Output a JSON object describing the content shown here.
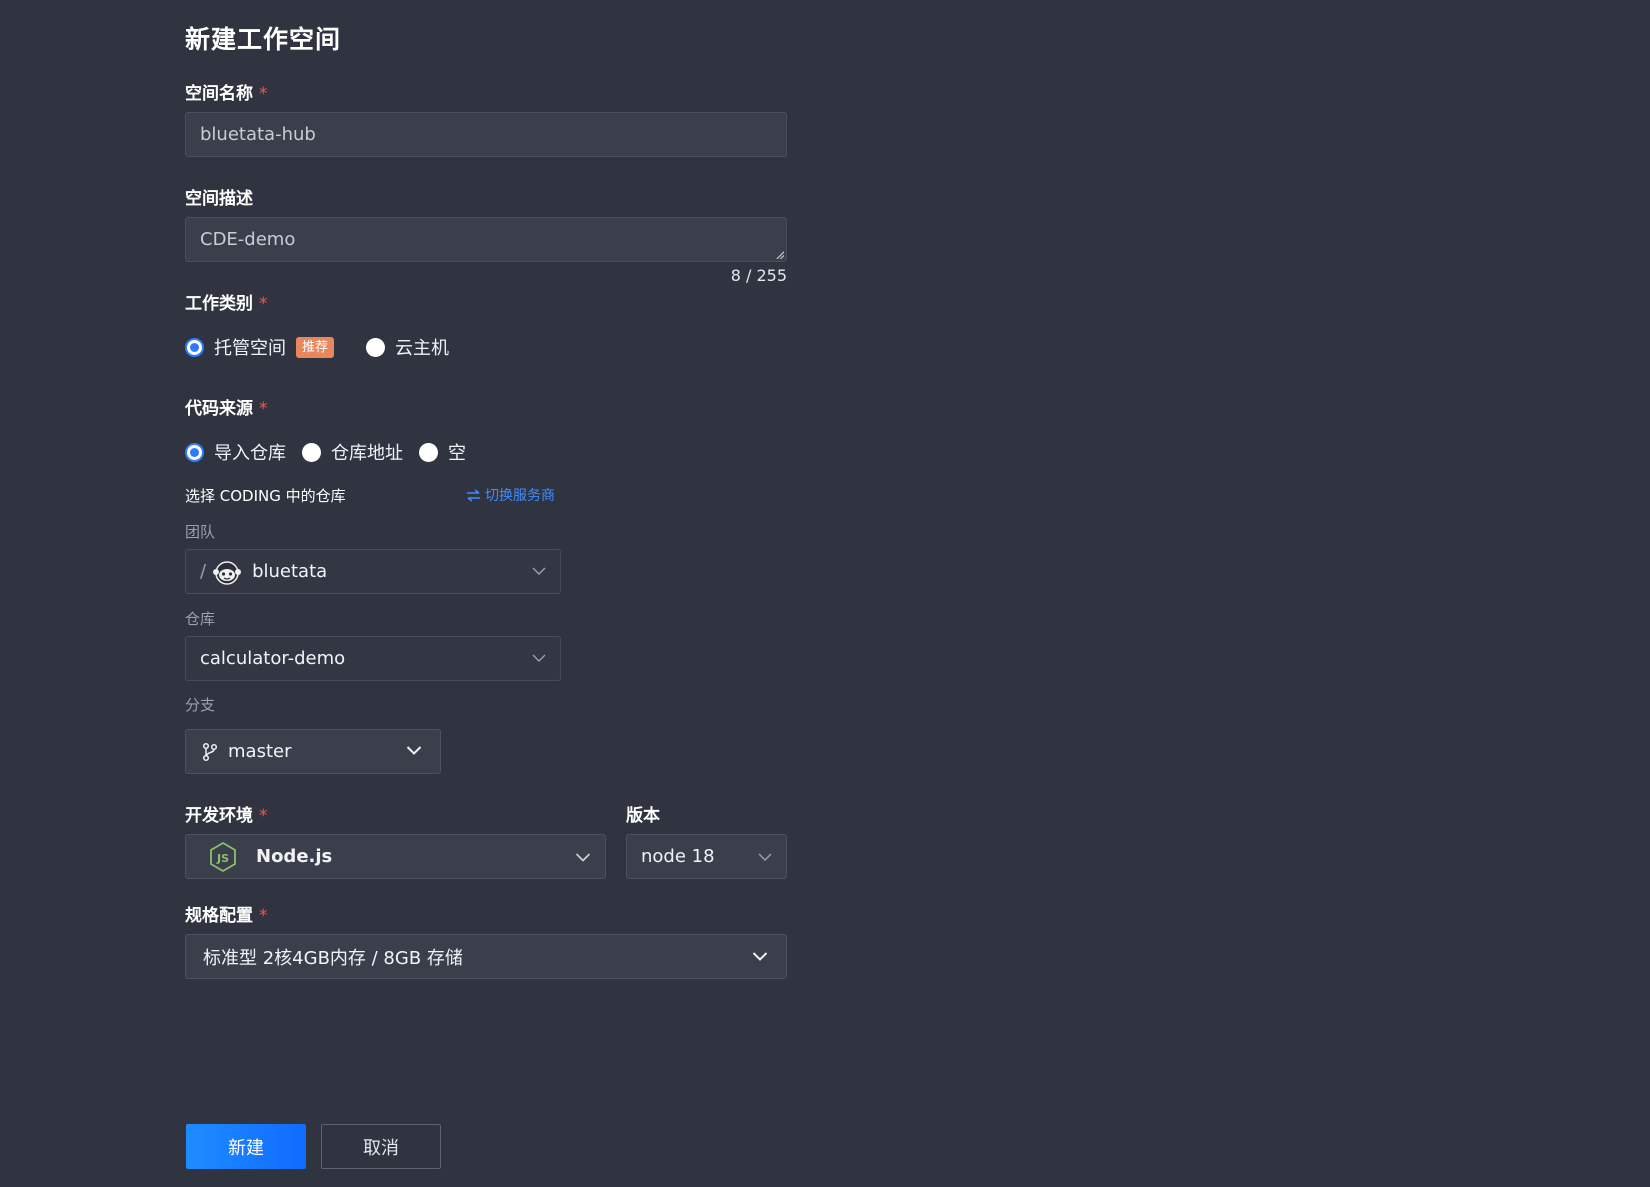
{
  "page": {
    "title": "新建工作空间"
  },
  "space_name": {
    "label": "空间名称",
    "required_mark": "*",
    "value": "bluetata-hub"
  },
  "space_desc": {
    "label": "空间描述",
    "value": "CDE-demo",
    "counter": "8 / 255"
  },
  "work_type": {
    "label": "工作类别",
    "required_mark": "*",
    "options": [
      {
        "label": "托管空间",
        "badge": "推荐",
        "checked": true
      },
      {
        "label": "云主机",
        "checked": false
      }
    ]
  },
  "code_source": {
    "label": "代码来源",
    "required_mark": "*",
    "options": [
      {
        "label": "导入仓库",
        "checked": true
      },
      {
        "label": "仓库地址",
        "checked": false
      },
      {
        "label": "空",
        "checked": false
      }
    ],
    "repo_section_title": "选择 CODING 中的仓库",
    "switch_provider_link": "切换服务商",
    "team": {
      "label": "团队",
      "prefix": "/",
      "value": "bluetata"
    },
    "repo": {
      "label": "仓库",
      "value": "calculator-demo"
    },
    "branch": {
      "label": "分支",
      "value": "master"
    }
  },
  "dev_env": {
    "label": "开发环境",
    "required_mark": "*",
    "value": "Node.js",
    "icon": "nodejs-icon"
  },
  "version": {
    "label": "版本",
    "value": "node 18"
  },
  "spec": {
    "label": "规格配置",
    "required_mark": "*",
    "value": "标准型 2核4GB内存 / 8GB 存储"
  },
  "actions": {
    "create": "新建",
    "cancel": "取消"
  },
  "colors": {
    "accent": "#2f7bff",
    "required": "#f2564a",
    "badge": "#e8875e",
    "background": "#303440"
  }
}
